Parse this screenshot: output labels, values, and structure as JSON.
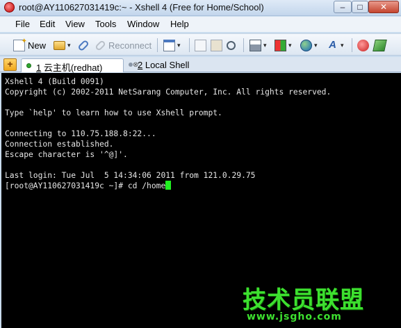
{
  "window": {
    "title": "root@AY110627031419c:~ - Xshell 4 (Free for Home/School)",
    "controls": {
      "minimize": "–",
      "maximize": "□",
      "close": "✕"
    }
  },
  "menu": [
    "File",
    "Edit",
    "View",
    "Tools",
    "Window",
    "Help"
  ],
  "toolbar": {
    "new_label": "New",
    "reconnect_label": "Reconnect",
    "dropdown_glyph": "▾",
    "reconnect_enabled": false
  },
  "tabs": [
    {
      "num": "1",
      "label": " 云主机(redhat)",
      "active": true,
      "close_glyph": "⊗"
    },
    {
      "num": "2",
      "label": " Local Shell",
      "active": false
    }
  ],
  "tab_add_glyph": "+",
  "terminal": {
    "lines": [
      "Xshell 4 (Build 0091)",
      "Copyright (c) 2002-2011 NetSarang Computer, Inc. All rights reserved.",
      "",
      "Type `help' to learn how to use Xshell prompt.",
      "",
      "Connecting to 110.75.188.8:22...",
      "Connection established.",
      "Escape character is '^@]'.",
      "",
      "Last login: Tue Jul  5 14:34:06 2011 from 121.0.29.75"
    ],
    "prompt": "[root@AY110627031419c ~]# ",
    "command": "cd /home"
  },
  "watermark": {
    "text": "技术员联盟",
    "url": "www.jsgho.com"
  },
  "colors": {
    "terminal_bg": "#000000",
    "terminal_fg": "#e6e6e6",
    "cursor": "#20f020",
    "watermark": "#3de02f"
  }
}
